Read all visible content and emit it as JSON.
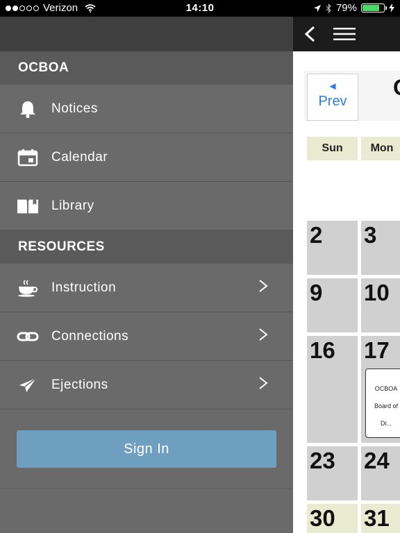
{
  "status_bar": {
    "carrier": "Verizon",
    "time": "14:10",
    "battery": "79%",
    "signal_bars": 2,
    "battery_level": 0.79
  },
  "menu": {
    "sections": [
      {
        "title": "OCBOA",
        "items": [
          {
            "label": "Notices",
            "icon": "bell-icon"
          },
          {
            "label": "Calendar",
            "icon": "calendar-icon"
          },
          {
            "label": "Library",
            "icon": "book-icon"
          }
        ]
      },
      {
        "title": "RESOURCES",
        "items": [
          {
            "label": "Instruction",
            "icon": "coffee-cup-icon",
            "chevron": true
          },
          {
            "label": "Connections",
            "icon": "link-icon",
            "chevron": true
          },
          {
            "label": "Ejections",
            "icon": "paper-plane-icon",
            "chevron": true
          }
        ]
      }
    ],
    "sign_in_label": "Sign In"
  },
  "calendar": {
    "prev_arrow": "◄",
    "prev_label": "Prev",
    "month_label_partial": "O",
    "day_headers": [
      "Sun",
      "Mon"
    ],
    "dates": {
      "sun": [
        "2",
        "9",
        "16",
        "23",
        "30"
      ],
      "mon": [
        "3",
        "10",
        "17",
        "24",
        "31"
      ]
    },
    "event": {
      "line1": "OCBOA",
      "line2": "Board of",
      "line3": "Di..."
    },
    "colors": {
      "header_bg": "#e8ebcf",
      "cell_bg": "#d0d0d0",
      "prev_blue": "#2a7de1",
      "signin_blue": "#6f9fc0"
    }
  }
}
